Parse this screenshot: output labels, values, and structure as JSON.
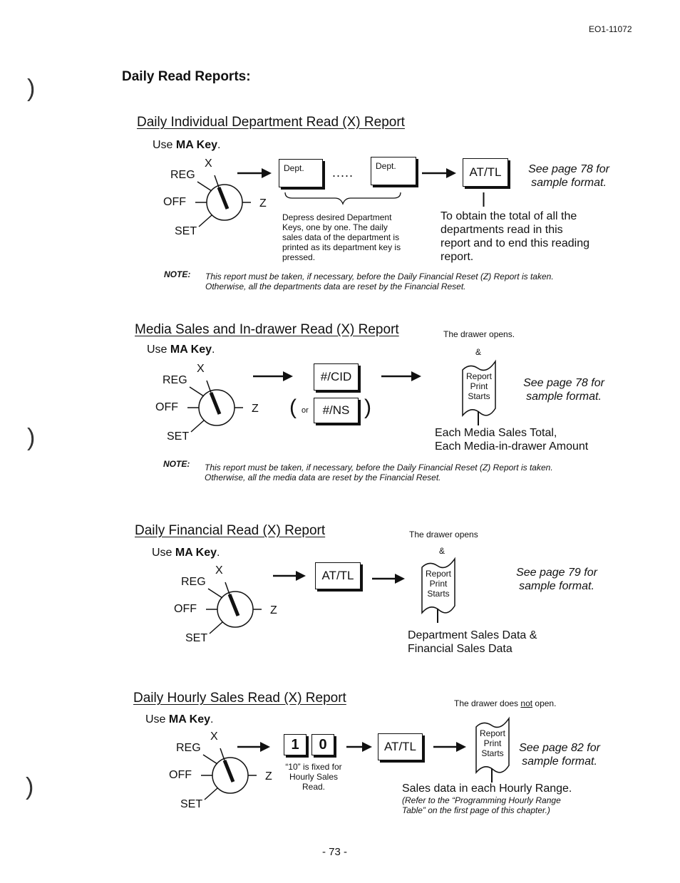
{
  "document_id": "EO1-11072",
  "page_heading": "Daily Read Reports:",
  "page_number": "- 73 -",
  "key_switch_labels": {
    "reg": "REG",
    "x": "X",
    "off": "OFF",
    "z": "Z",
    "set": "SET"
  },
  "use_key": {
    "prefix": "Use ",
    "key": "MA Key",
    "suffix": "."
  },
  "sections": [
    {
      "title": "Daily Individual Department Read (X) Report",
      "keys": [
        "Dept.",
        "Dept."
      ],
      "ellipsis": ".....",
      "keys_caption": [
        "Depress desired Department",
        "Keys, one by one.  The daily",
        "sales data of the department is",
        "printed as its department key is",
        "pressed."
      ],
      "final_key": "AT/TL",
      "see_page": [
        "See page 78 for",
        "sample format."
      ],
      "result": [
        "To obtain the total of all the",
        "departments read in this",
        "report and to end this reading",
        "report."
      ],
      "note_label": "NOTE:",
      "note": [
        "This report must be taken, if necessary, before the Daily Financial Reset (Z) Report is taken.",
        "Otherwise, all the departments data are reset by the Financial Reset."
      ]
    },
    {
      "title": "Media Sales and In-drawer Read (X) Report",
      "keys": [
        "#/CID",
        "#/NS"
      ],
      "or_label": "or",
      "drawer": "The drawer opens.",
      "amp": "&",
      "report_print": [
        "Report",
        "Print",
        "Starts"
      ],
      "see_page": [
        "See page 78 for",
        "sample format."
      ],
      "result": [
        "Each Media Sales Total,",
        "Each Media-in-drawer Amount"
      ],
      "note_label": "NOTE:",
      "note": [
        "This report must be taken, if necessary, before the Daily Financial Reset (Z) Report is taken.",
        "Otherwise, all the media data are reset by the Financial Reset."
      ]
    },
    {
      "title": "Daily Financial Read (X) Report",
      "keys": [
        "AT/TL"
      ],
      "drawer": "The drawer opens",
      "amp": "&",
      "report_print": [
        "Report",
        "Print",
        "Starts"
      ],
      "see_page": [
        "See page 79 for",
        "sample format."
      ],
      "result": [
        "Department Sales Data &",
        "Financial Sales Data"
      ]
    },
    {
      "title": "Daily Hourly Sales Read (X) Report",
      "keys": [
        "1",
        "0",
        "AT/TL"
      ],
      "keys_caption": [
        "“10” is fixed for",
        "Hourly Sales",
        "Read."
      ],
      "drawer_pre": "The drawer does ",
      "drawer_not": "not",
      "drawer_post": " open.",
      "report_print": [
        "Report",
        "Print",
        "Starts"
      ],
      "see_page": [
        "See page 82 for",
        "sample format."
      ],
      "result": "Sales data in each Hourly Range.",
      "result_note": [
        "(Refer to the “Programming Hourly Range",
        "Table” on the first page of this chapter.)"
      ]
    }
  ],
  "margin_marks": [
    ")",
    ")",
    ")"
  ]
}
